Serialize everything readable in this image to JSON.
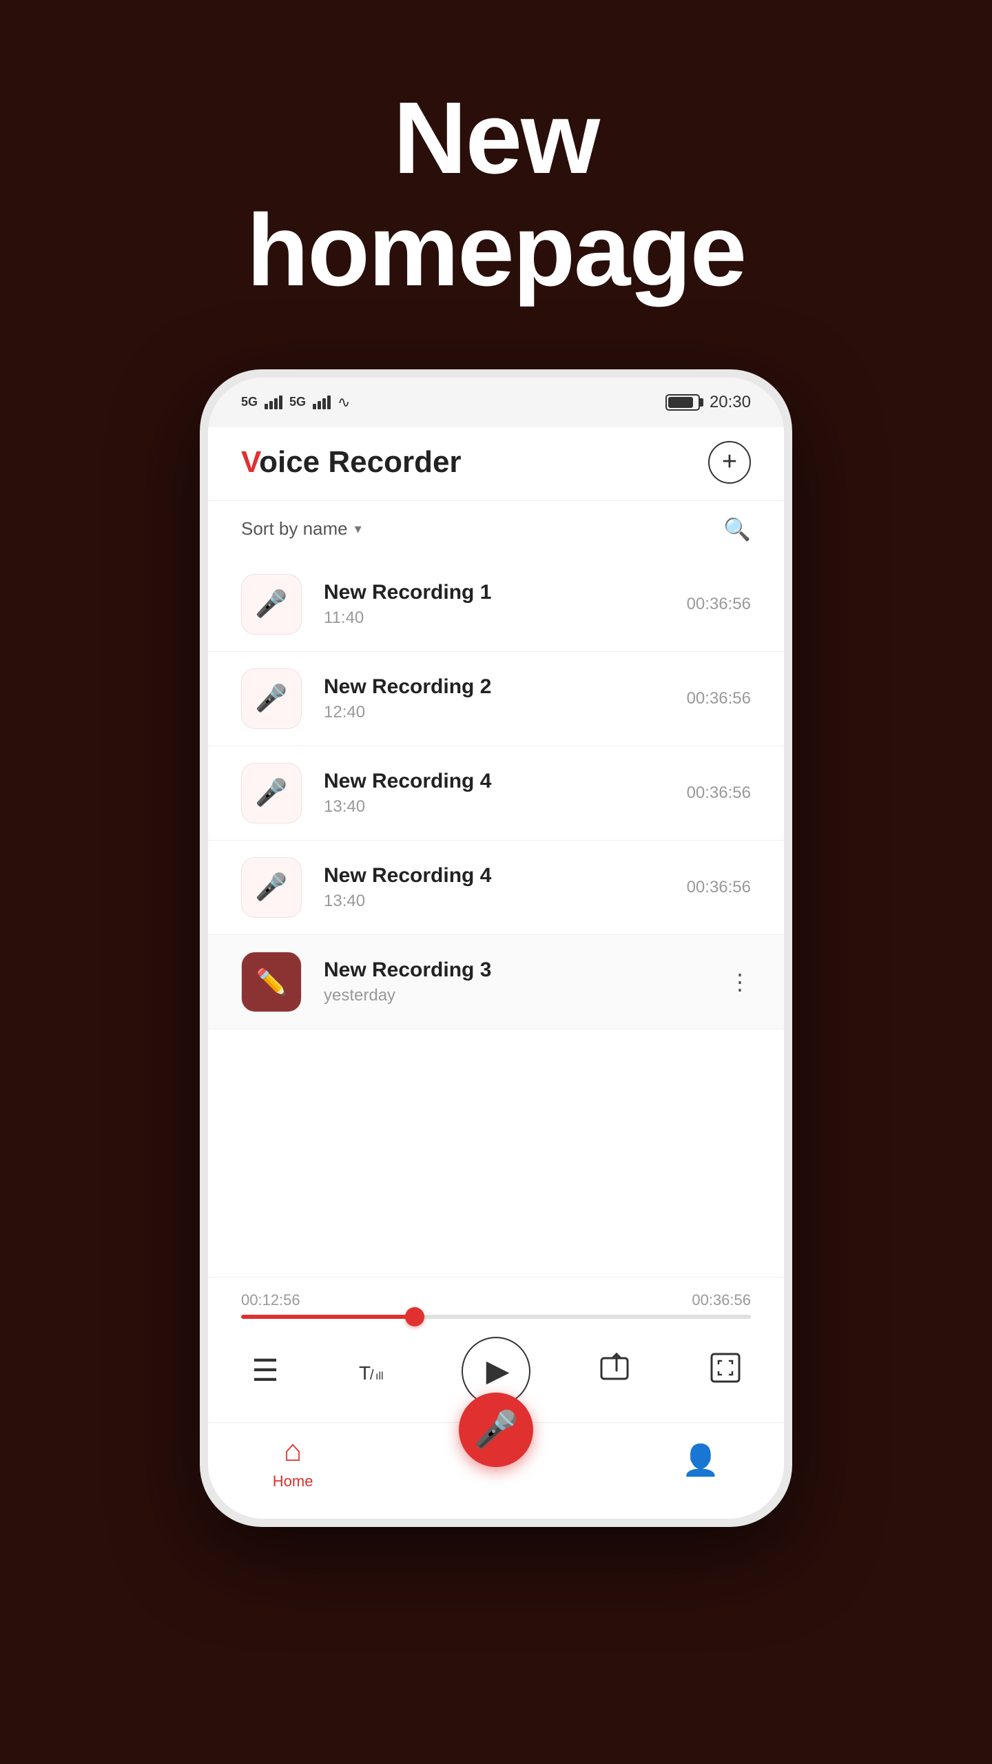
{
  "headline": {
    "line1": "New",
    "line2": "homepage"
  },
  "status_bar": {
    "network1": "5G",
    "network2": "5G",
    "time": "20:30"
  },
  "app_header": {
    "title_v": "V",
    "title_rest": "oice Recorder",
    "add_button_label": "+"
  },
  "sort_bar": {
    "sort_label": "Sort by name",
    "chevron": "▾"
  },
  "recordings": [
    {
      "name": "New Recording 1",
      "time": "11:40",
      "duration": "00:36:56",
      "icon_type": "mic",
      "active": false
    },
    {
      "name": "New Recording 2",
      "time": "12:40",
      "duration": "00:36:56",
      "icon_type": "mic",
      "active": false
    },
    {
      "name": "New Recording 4",
      "time": "13:40",
      "duration": "00:36:56",
      "icon_type": "mic",
      "active": false
    },
    {
      "name": "New Recording 4",
      "time": "13:40",
      "duration": "00:36:56",
      "icon_type": "mic",
      "active": false
    },
    {
      "name": "New Recording 3",
      "time": "yesterday",
      "duration": "",
      "icon_type": "edit",
      "active": true
    }
  ],
  "playback": {
    "current_time": "00:12:56",
    "total_time": "00:36:56",
    "progress_percent": 34
  },
  "nav": {
    "home_label": "Home",
    "profile_label": ""
  }
}
